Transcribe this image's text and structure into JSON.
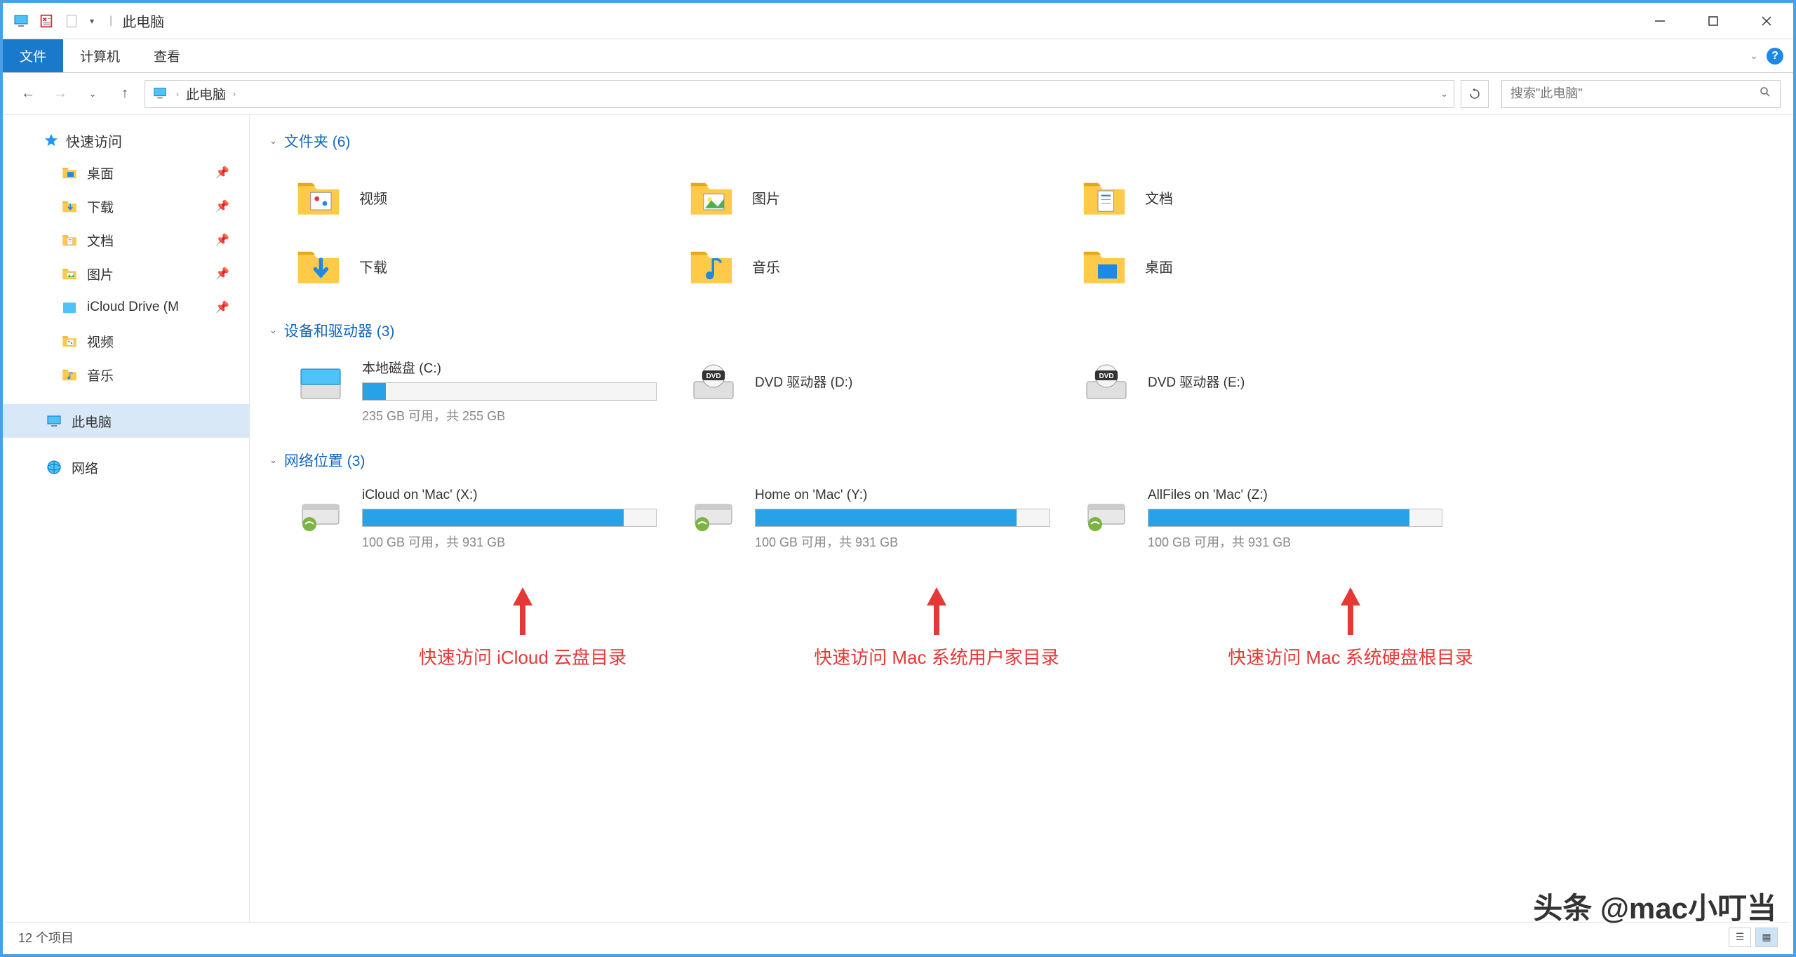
{
  "title": "此电脑",
  "ribbon": {
    "file": "文件",
    "computer": "计算机",
    "view": "查看"
  },
  "address": {
    "location": "此电脑"
  },
  "search": {
    "placeholder": "搜索\"此电脑\""
  },
  "sidebar": {
    "quick_access": "快速访问",
    "items": [
      {
        "label": "桌面",
        "pinned": true,
        "icon": "desktop"
      },
      {
        "label": "下载",
        "pinned": true,
        "icon": "downloads"
      },
      {
        "label": "文档",
        "pinned": true,
        "icon": "documents"
      },
      {
        "label": "图片",
        "pinned": true,
        "icon": "pictures"
      },
      {
        "label": "iCloud Drive (M",
        "pinned": true,
        "icon": "icloud"
      },
      {
        "label": "视频",
        "pinned": false,
        "icon": "videos"
      },
      {
        "label": "音乐",
        "pinned": false,
        "icon": "music"
      }
    ],
    "this_pc": "此电脑",
    "network": "网络"
  },
  "groups": {
    "folders": {
      "title": "文件夹 (6)",
      "items": [
        {
          "label": "视频",
          "icon": "videos"
        },
        {
          "label": "图片",
          "icon": "pictures"
        },
        {
          "label": "文档",
          "icon": "documents"
        },
        {
          "label": "下载",
          "icon": "downloads"
        },
        {
          "label": "音乐",
          "icon": "music"
        },
        {
          "label": "桌面",
          "icon": "desktop"
        }
      ]
    },
    "devices": {
      "title": "设备和驱动器 (3)",
      "items": [
        {
          "name": "本地磁盘 (C:)",
          "stats": "235 GB 可用，共 255 GB",
          "fill": 8,
          "type": "disk"
        },
        {
          "name": "DVD 驱动器 (D:)",
          "type": "dvd"
        },
        {
          "name": "DVD 驱动器 (E:)",
          "type": "dvd"
        }
      ]
    },
    "network": {
      "title": "网络位置 (3)",
      "items": [
        {
          "name": "iCloud on 'Mac' (X:)",
          "stats": "100 GB 可用，共 931 GB",
          "fill": 89
        },
        {
          "name": "Home on 'Mac' (Y:)",
          "stats": "100 GB 可用，共 931 GB",
          "fill": 89
        },
        {
          "name": "AllFiles on 'Mac' (Z:)",
          "stats": "100 GB 可用，共 931 GB",
          "fill": 89
        }
      ]
    }
  },
  "annotations": [
    "快速访问 iCloud 云盘目录",
    "快速访问 Mac 系统用户家目录",
    "快速访问 Mac 系统硬盘根目录"
  ],
  "status": {
    "count": "12 个项目"
  },
  "watermark": "头条 @mac小叮当"
}
